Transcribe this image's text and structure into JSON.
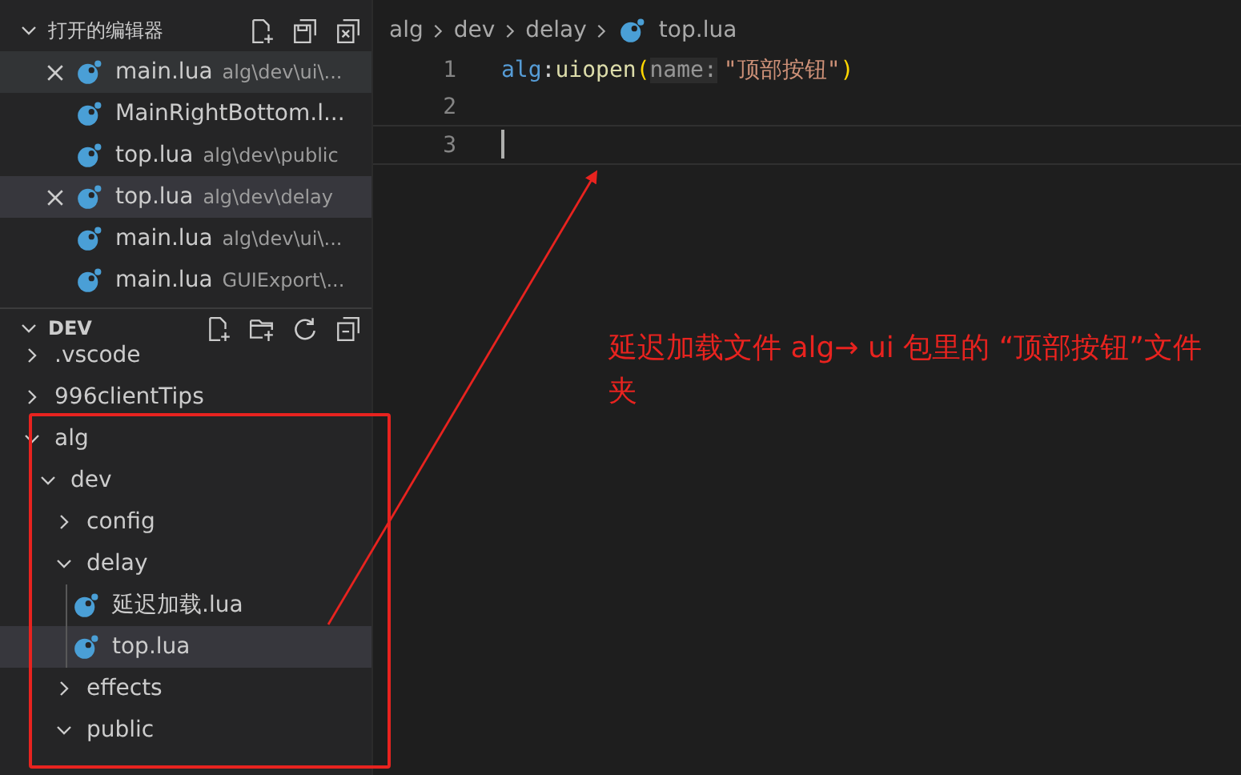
{
  "open_editors": {
    "title": "打开的编辑器",
    "items": [
      {
        "name": "main.lua",
        "path": "alg\\dev\\ui\\...",
        "selected": false,
        "hovered": true,
        "show_close": true
      },
      {
        "name": "MainRightBottom.l...",
        "selected": false,
        "hovered": false,
        "show_close": false
      },
      {
        "name": "top.lua",
        "path": "alg\\dev\\public",
        "selected": false,
        "hovered": false,
        "show_close": false
      },
      {
        "name": "top.lua",
        "path": "alg\\dev\\delay",
        "selected": true,
        "hovered": false,
        "show_close": true
      },
      {
        "name": "main.lua",
        "path": "alg\\dev\\ui\\...",
        "selected": false,
        "hovered": false,
        "show_close": false
      },
      {
        "name": "main.lua",
        "path": "GUIExport\\...",
        "selected": false,
        "hovered": false,
        "show_close": false
      }
    ]
  },
  "explorer": {
    "title": "DEV",
    "tree": [
      {
        "name": ".vscode",
        "kind": "folder",
        "expanded": false,
        "selected": false
      },
      {
        "name": "996clientTips",
        "kind": "folder",
        "expanded": false,
        "selected": false
      },
      {
        "name": "alg",
        "kind": "folder",
        "expanded": true,
        "selected": false,
        "children": [
          {
            "name": "dev",
            "kind": "folder",
            "expanded": true,
            "selected": false,
            "children": [
              {
                "name": "config",
                "kind": "folder",
                "expanded": false,
                "selected": false
              },
              {
                "name": "delay",
                "kind": "folder",
                "expanded": true,
                "selected": false,
                "children": [
                  {
                    "name": "延迟加载.lua",
                    "kind": "file",
                    "selected": false
                  },
                  {
                    "name": "top.lua",
                    "kind": "file",
                    "selected": true
                  }
                ]
              },
              {
                "name": "effects",
                "kind": "folder",
                "expanded": false,
                "selected": false
              },
              {
                "name": "public",
                "kind": "folder",
                "expanded": true,
                "selected": false
              }
            ]
          }
        ]
      }
    ]
  },
  "editor": {
    "breadcrumbs": [
      "alg",
      "dev",
      "delay"
    ],
    "breadcrumb_file": "top.lua",
    "lines": [
      {
        "number": "1",
        "tokens": [
          {
            "kind": "variable",
            "text": "alg"
          },
          {
            "kind": "plain",
            "text": ":"
          },
          {
            "kind": "function",
            "text": "uiopen"
          },
          {
            "kind": "bracket",
            "text": "("
          },
          {
            "kind": "hint",
            "text": "name:"
          },
          {
            "kind": "string",
            "text": "\"顶部按钮\""
          },
          {
            "kind": "bracket",
            "text": ")"
          }
        ]
      },
      {
        "number": "2"
      },
      {
        "number": "3",
        "cursor": true
      }
    ]
  },
  "annotation": {
    "text": "延迟加载文件 alg→ ui 包里的 “顶部按钮”文件夹"
  }
}
